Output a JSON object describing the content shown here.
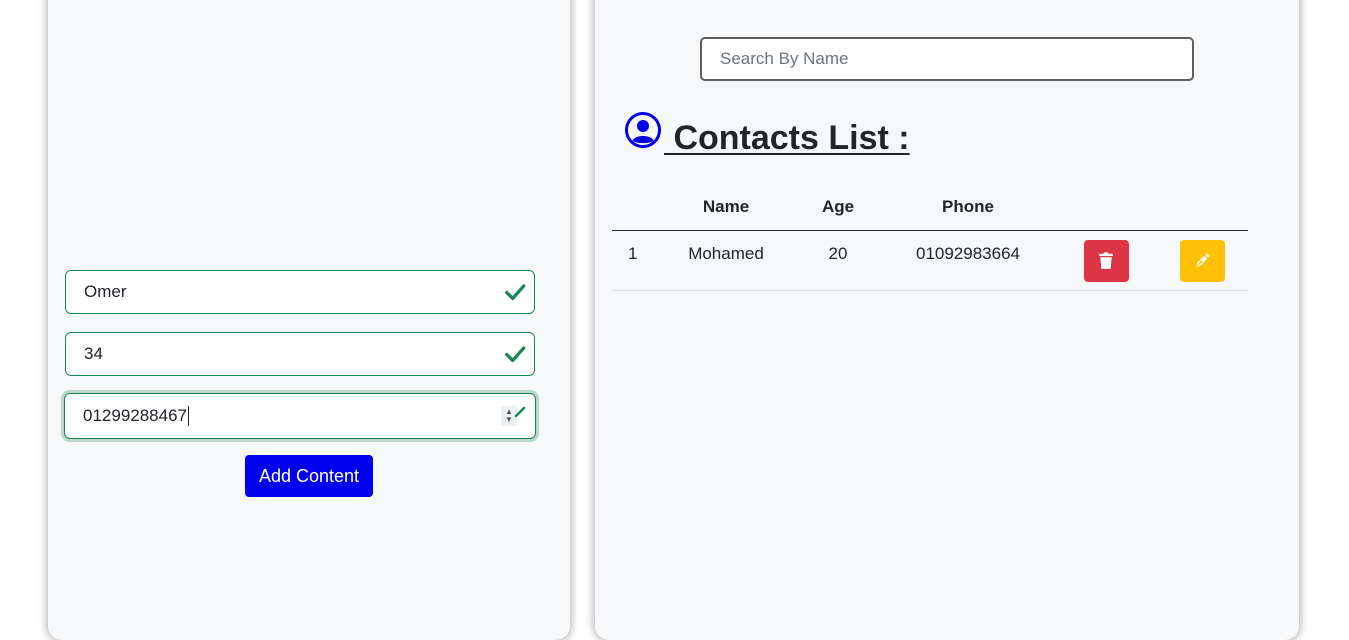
{
  "form": {
    "name_value": "Omer",
    "age_value": "34",
    "phone_value": "01299288467",
    "add_button_label": "Add Content",
    "valid_color": "#198754",
    "button_color": "#0000ee"
  },
  "contacts": {
    "search_placeholder": "Search By Name",
    "title": " Contacts List :",
    "title_icon": "user-circle-icon",
    "icon_color": "#0000ee",
    "columns": [
      "",
      "Name",
      "Age",
      "Phone",
      "",
      ""
    ],
    "rows": [
      {
        "index": "1",
        "name": "Mohamed",
        "age": "20",
        "phone": "01092983664"
      }
    ],
    "delete_icon": "trash-icon",
    "edit_icon": "pen-icon",
    "delete_color": "#dc3545",
    "edit_color": "#ffc107"
  }
}
